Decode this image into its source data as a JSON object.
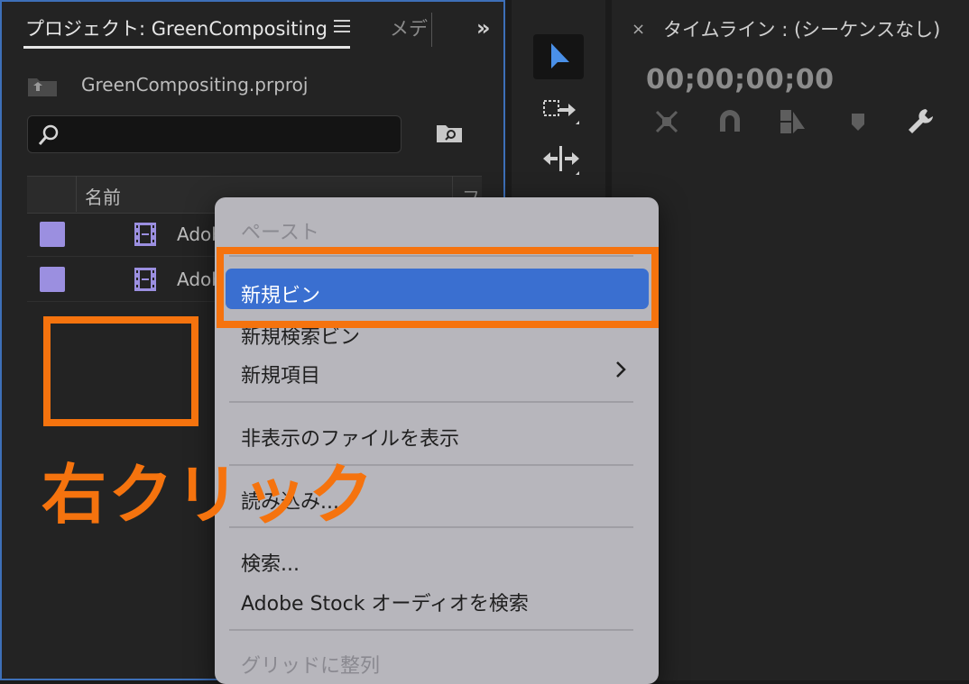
{
  "project_panel": {
    "tab_label": "プロジェクト: GreenCompositing",
    "media_tab_label": "メデ",
    "filename": "GreenCompositing.prproj",
    "search_placeholder": "",
    "columns": {
      "name": "名前",
      "extra": "フ"
    },
    "rows": [
      {
        "name": "Adobe",
        "swatch_color": "#9b8fe0"
      },
      {
        "name": "Adobe",
        "swatch_color": "#9b8fe0"
      }
    ]
  },
  "timeline_panel": {
    "close_glyph": "×",
    "title": "タイムライン : (シーケンスなし)",
    "timecode": "00;00;00;00"
  },
  "context_menu": {
    "items": [
      {
        "label": "ペースト",
        "enabled": false
      },
      {
        "label": "新規ビン",
        "enabled": true,
        "highlighted": true
      },
      {
        "label": "新規検索ビン",
        "enabled": true
      },
      {
        "label": "新規項目",
        "enabled": true,
        "submenu": true
      },
      {
        "label": "非表示のファイルを表示",
        "enabled": true
      },
      {
        "label": "読み込み...",
        "enabled": true
      },
      {
        "label": "検索...",
        "enabled": true
      },
      {
        "label": "Adobe Stock オーディオを検索",
        "enabled": true
      },
      {
        "label": "グリッドに整列",
        "enabled": false
      }
    ]
  },
  "annotation": {
    "label": "右クリック",
    "color": "#f5730e"
  },
  "colors": {
    "accent": "#3a6fd0",
    "panel_border": "#3d6fb8",
    "tool_active": "#4a90e8"
  }
}
